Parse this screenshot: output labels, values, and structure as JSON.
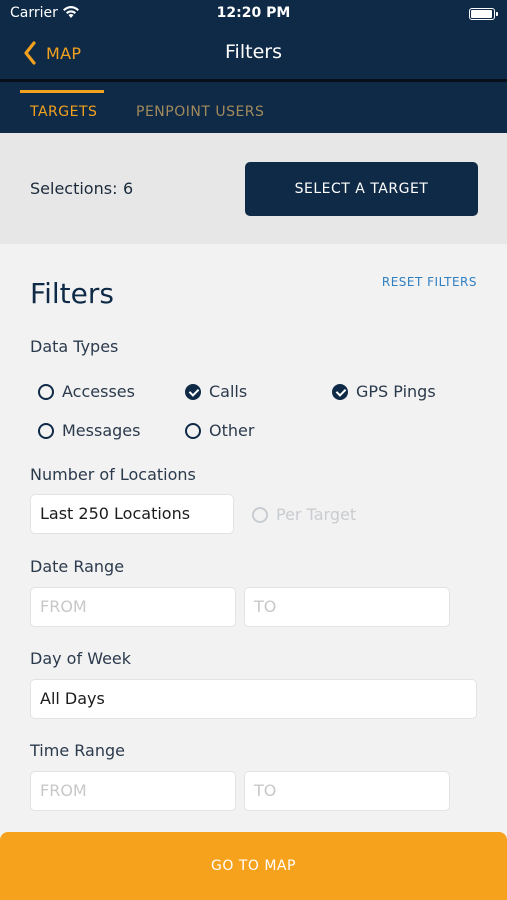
{
  "status_bar": {
    "carrier": "Carrier",
    "time": "12:20 PM"
  },
  "nav": {
    "back_label": "MAP",
    "title": "Filters"
  },
  "tabs": [
    {
      "label": "TARGETS",
      "active": true
    },
    {
      "label": "PENPOINT USERS",
      "active": false
    }
  ],
  "selection": {
    "label": "Selections:",
    "count": "6",
    "button": "SELECT A TARGET"
  },
  "filters": {
    "heading": "Filters",
    "reset": "RESET FILTERS",
    "data_types": {
      "label": "Data Types",
      "options": [
        {
          "label": "Accesses",
          "checked": false
        },
        {
          "label": "Calls",
          "checked": true
        },
        {
          "label": "GPS Pings",
          "checked": true
        },
        {
          "label": "Messages",
          "checked": false
        },
        {
          "label": "Other",
          "checked": false
        }
      ]
    },
    "locations": {
      "label": "Number of Locations",
      "value": "Last 250 Locations",
      "per_target": "Per Target"
    },
    "date_range": {
      "label": "Date Range",
      "from_placeholder": "FROM",
      "to_placeholder": "TO"
    },
    "day_of_week": {
      "label": "Day of Week",
      "value": "All Days"
    },
    "time_range": {
      "label": "Time Range",
      "from_placeholder": "FROM",
      "to_placeholder": "TO"
    }
  },
  "footer": {
    "button": "GO TO MAP"
  },
  "colors": {
    "navy": "#0f2a47",
    "accent": "#f7a21c",
    "link": "#2f7fc1"
  }
}
